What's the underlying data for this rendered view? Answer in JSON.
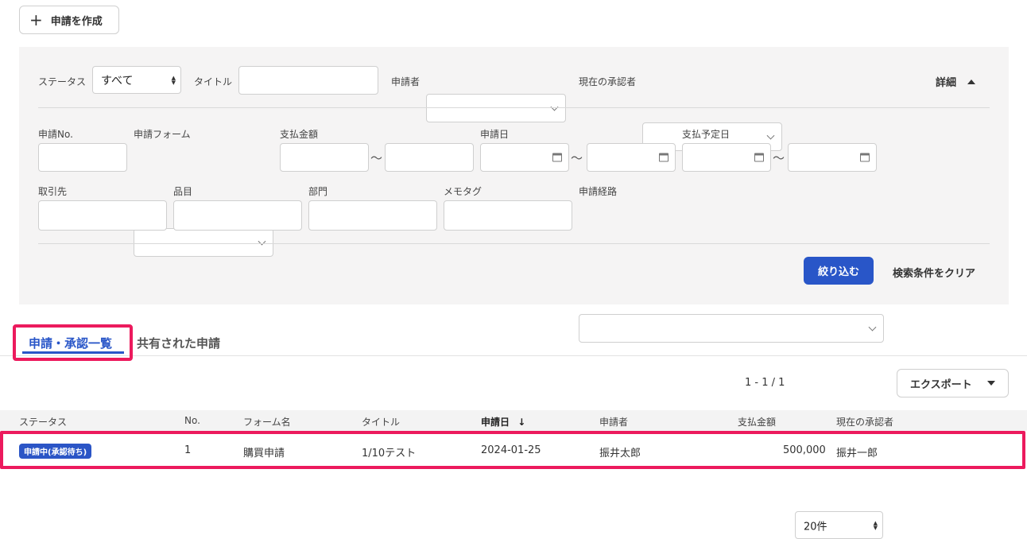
{
  "actions": {
    "create_label": "申請を作成",
    "create_icon": "plus-icon"
  },
  "filters": {
    "status_label": "ステータス",
    "status_value": "すべて",
    "title_label": "タイトル",
    "applicant_label": "申請者",
    "current_approver_label": "現在の承認者",
    "detail_label": "詳細",
    "request_no_label": "申請No.",
    "request_form_label": "申請フォーム",
    "payment_amount_label": "支払金額",
    "request_date_label": "申請日",
    "payment_due_date_label": "支払予定日",
    "range_sep": "～",
    "partner_label": "取引先",
    "item_label": "品目",
    "department_label": "部門",
    "memo_tag_label": "メモタグ",
    "route_label": "申請経路",
    "apply_label": "絞り込む",
    "clear_label": "検索条件をクリア"
  },
  "tabs": [
    {
      "label": "申請・承認一覧",
      "active": true
    },
    {
      "label": "共有された申請",
      "active": false
    }
  ],
  "list_toolbar": {
    "pagination": "1 - 1 / 1",
    "page_size": "20件",
    "export_label": "エクスポート"
  },
  "table": {
    "columns": [
      "ステータス",
      "No.",
      "フォーム名",
      "タイトル",
      "申請日",
      "申請者",
      "支払金額",
      "現在の承認者"
    ],
    "sort_column": "申請日",
    "sort_direction": "desc",
    "rows": [
      {
        "status": "申請中(承認待ち)",
        "no": "1",
        "form": "購買申請",
        "title": "1/10テスト",
        "date": "2024-01-25",
        "applicant": "振井太郎",
        "amount": "500,000",
        "approver": "振井一郎"
      }
    ]
  },
  "colors": {
    "accent": "#2956c8",
    "highlight": "#ec1a5d",
    "panel_bg": "#f5f4f4"
  }
}
